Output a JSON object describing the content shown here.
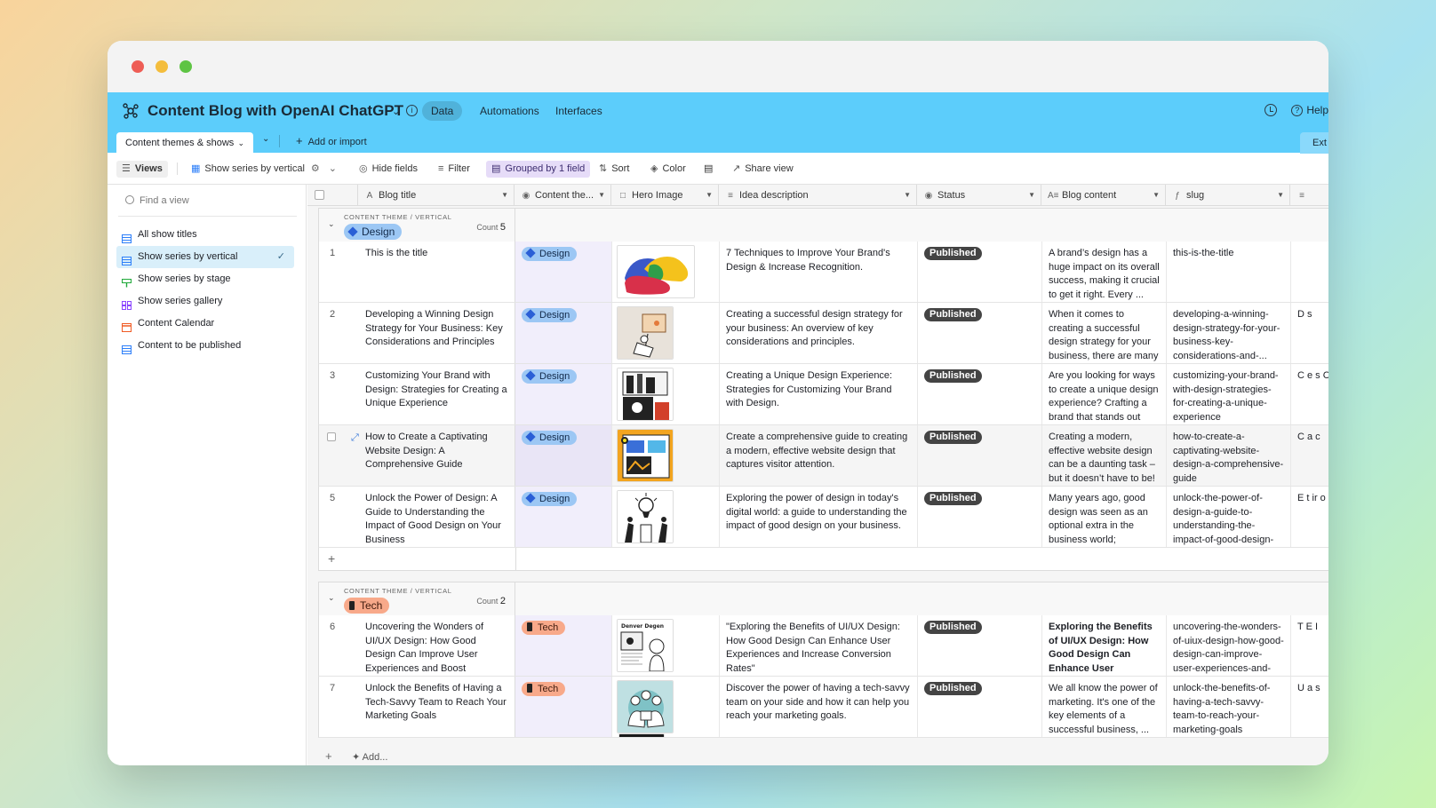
{
  "app": {
    "title": "Content Blog with OpenAI ChatGPT",
    "tabs": [
      "Data",
      "Automations",
      "Interfaces"
    ],
    "help": "Help"
  },
  "tablebar": {
    "active_table": "Content themes & shows",
    "add_import": "Add or import",
    "ext": "Ext"
  },
  "toolbar": {
    "views": "Views",
    "current_view": "Show series by vertical",
    "hide_fields": "Hide fields",
    "filter": "Filter",
    "grouped": "Grouped by 1 field",
    "sort": "Sort",
    "color": "Color",
    "share": "Share view"
  },
  "sidebar": {
    "search_placeholder": "Find a view",
    "views": [
      {
        "label": "All show titles",
        "icon": "grid-view-icon",
        "color": "#2d7ff9"
      },
      {
        "label": "Show series by vertical",
        "icon": "grid-view-icon",
        "color": "#2d7ff9",
        "active": true
      },
      {
        "label": "Show series by stage",
        "icon": "kanban-view-icon",
        "color": "#20a93a"
      },
      {
        "label": "Show series gallery",
        "icon": "gallery-view-icon",
        "color": "#8b46ff"
      },
      {
        "label": "Content Calendar",
        "icon": "calendar-view-icon",
        "color": "#f05a24"
      },
      {
        "label": "Content to be published",
        "icon": "grid-view-icon",
        "color": "#2d7ff9"
      }
    ]
  },
  "columns": [
    "Blog title",
    "Content the...",
    "Hero Image",
    "Idea description",
    "Status",
    "Blog content",
    "slug"
  ],
  "groups": [
    {
      "label": "CONTENT THEME / VERTICAL",
      "name": "Design",
      "count_label": "Count",
      "count": "5",
      "rows": [
        {
          "num": "1",
          "title": "This is the title",
          "idea": "7 Techniques to Improve Your Brand's Design & Increase Recognition.",
          "status": "Published",
          "blog": "A brand’s design has a huge impact on its overall success, making it crucial to get it right. Every ...",
          "slug": "this-is-the-title",
          "extra": ""
        },
        {
          "num": "2",
          "title": "Developing a Winning Design Strategy for Your Business: Key Considerations and Principles",
          "idea": "Creating a successful design strategy for your business: An overview of key considerations and principles.",
          "status": "Published",
          "blog": "When it comes to creating a successful design strategy for your business, there are many ...",
          "slug": "developing-a-winning-design-strategy-for-your-business-key-considerations-and-...",
          "extra": "D s"
        },
        {
          "num": "3",
          "title": "Customizing Your Brand with Design: Strategies for Creating a Unique Experience",
          "idea": "Creating a Unique Design Experience: Strategies for Customizing Your Brand with Design.",
          "status": "Published",
          "blog": "Are you looking for ways to create a unique design experience? Crafting a brand that stands out fro...",
          "slug": "customizing-your-brand-with-design-strategies-for-creating-a-unique-experience",
          "extra": "C e s C"
        },
        {
          "num": "",
          "title": "How to Create a Captivating Website Design: A Comprehensive Guide",
          "idea": "Create a comprehensive guide to creating a modern, effective website design that captures visitor attention.",
          "status": "Published",
          "blog": "Creating a modern, effective website design can be a daunting task – but it doesn’t have to be! ...",
          "slug": "how-to-create-a-captivating-website-design-a-comprehensive-guide",
          "extra": "C a c"
        },
        {
          "num": "5",
          "title": "Unlock the Power of Design: A Guide to Understanding the Impact of Good Design on Your Business",
          "idea": "Exploring the power of design in today's digital world: a guide to understanding the impact of good design on your business.",
          "status": "Published",
          "blog": "Many years ago, good design was seen as an optional extra in the business world; somethin...",
          "slug": "unlock-the-power-of-design-a-guide-to-understanding-the-impact-of-good-design-on-your-...",
          "extra": "E t ir o"
        }
      ]
    },
    {
      "label": "CONTENT THEME / VERTICAL",
      "name": "Tech",
      "count_label": "Count",
      "count": "2",
      "rows": [
        {
          "num": "6",
          "title": "Uncovering the Wonders of UI/UX Design: How Good Design Can Improve User Experiences and Boost Conversion Rates",
          "idea": "\"Exploring the Benefits of UI/UX Design: How Good Design Can Enhance User Experiences and Increase Conversion Rates\"",
          "status": "Published",
          "blog": "Exploring the Benefits of UI/UX Design: How Good Design Can Enhance User Experiences and Increas...",
          "slug": "uncovering-the-wonders-of-uiux-design-how-good-design-can-improve-user-experiences-and-boost-...",
          "extra": "T E I"
        },
        {
          "num": "7",
          "title": "Unlock the Benefits of Having a Tech-Savvy Team to Reach Your Marketing Goals",
          "idea": "Discover the power of having a tech-savvy team on your side and how it can help you reach your marketing goals.",
          "status": "Published",
          "blog": "We all know the power of marketing. It's one of the key elements of a successful business, ...",
          "slug": "unlock-the-benefits-of-having-a-tech-savvy-team-to-reach-your-marketing-goals",
          "extra": "U a s"
        }
      ]
    }
  ],
  "hero_thumb_text": {
    "row6": "Denver Degen"
  },
  "footer": {
    "add": "Add..."
  }
}
